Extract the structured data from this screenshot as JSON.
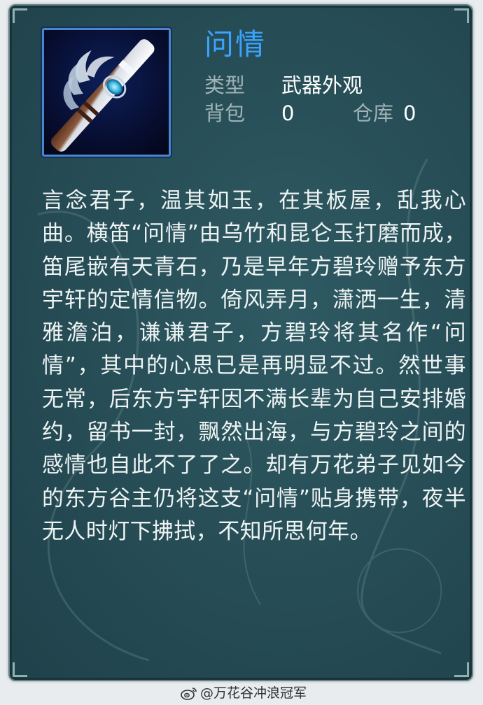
{
  "item": {
    "name": "问情",
    "icon": "flute-weapon-icon",
    "type_label": "类型",
    "type_value": "武器外观",
    "bag_label": "背包",
    "bag_count": "0",
    "warehouse_label": "仓库",
    "warehouse_count": "0",
    "description": "言念君子，温其如玉，在其板屋，乱我心曲。横笛“问情”由乌竹和昆仑玉打磨而成，笛尾嵌有天青石，乃是早年方碧玲赠予东方宇轩的定情信物。倚风弄月，潇洒一生，清雅澹泊，谦谦君子，方碧玲将其名作“问情”，其中的心思已是再明显不过。然世事无常，后东方宇轩因不满长辈为自己安排婚约，留书一封，飘然出海，与方碧玲之间的感情也自此不了了之。却有万花弟子见如今的东方谷主仍将这支“问情”贴身携带，夜半无人时灯下拂拭，不知所思何年。"
  },
  "watermark": {
    "icon": "weibo-icon",
    "text": "@万花谷冲浪冠军"
  },
  "colors": {
    "panel": "#264c55",
    "title": "#3aa3ff",
    "label": "#9fb3b6",
    "text": "#eef3f3",
    "icon_border": "#4a86c9"
  }
}
